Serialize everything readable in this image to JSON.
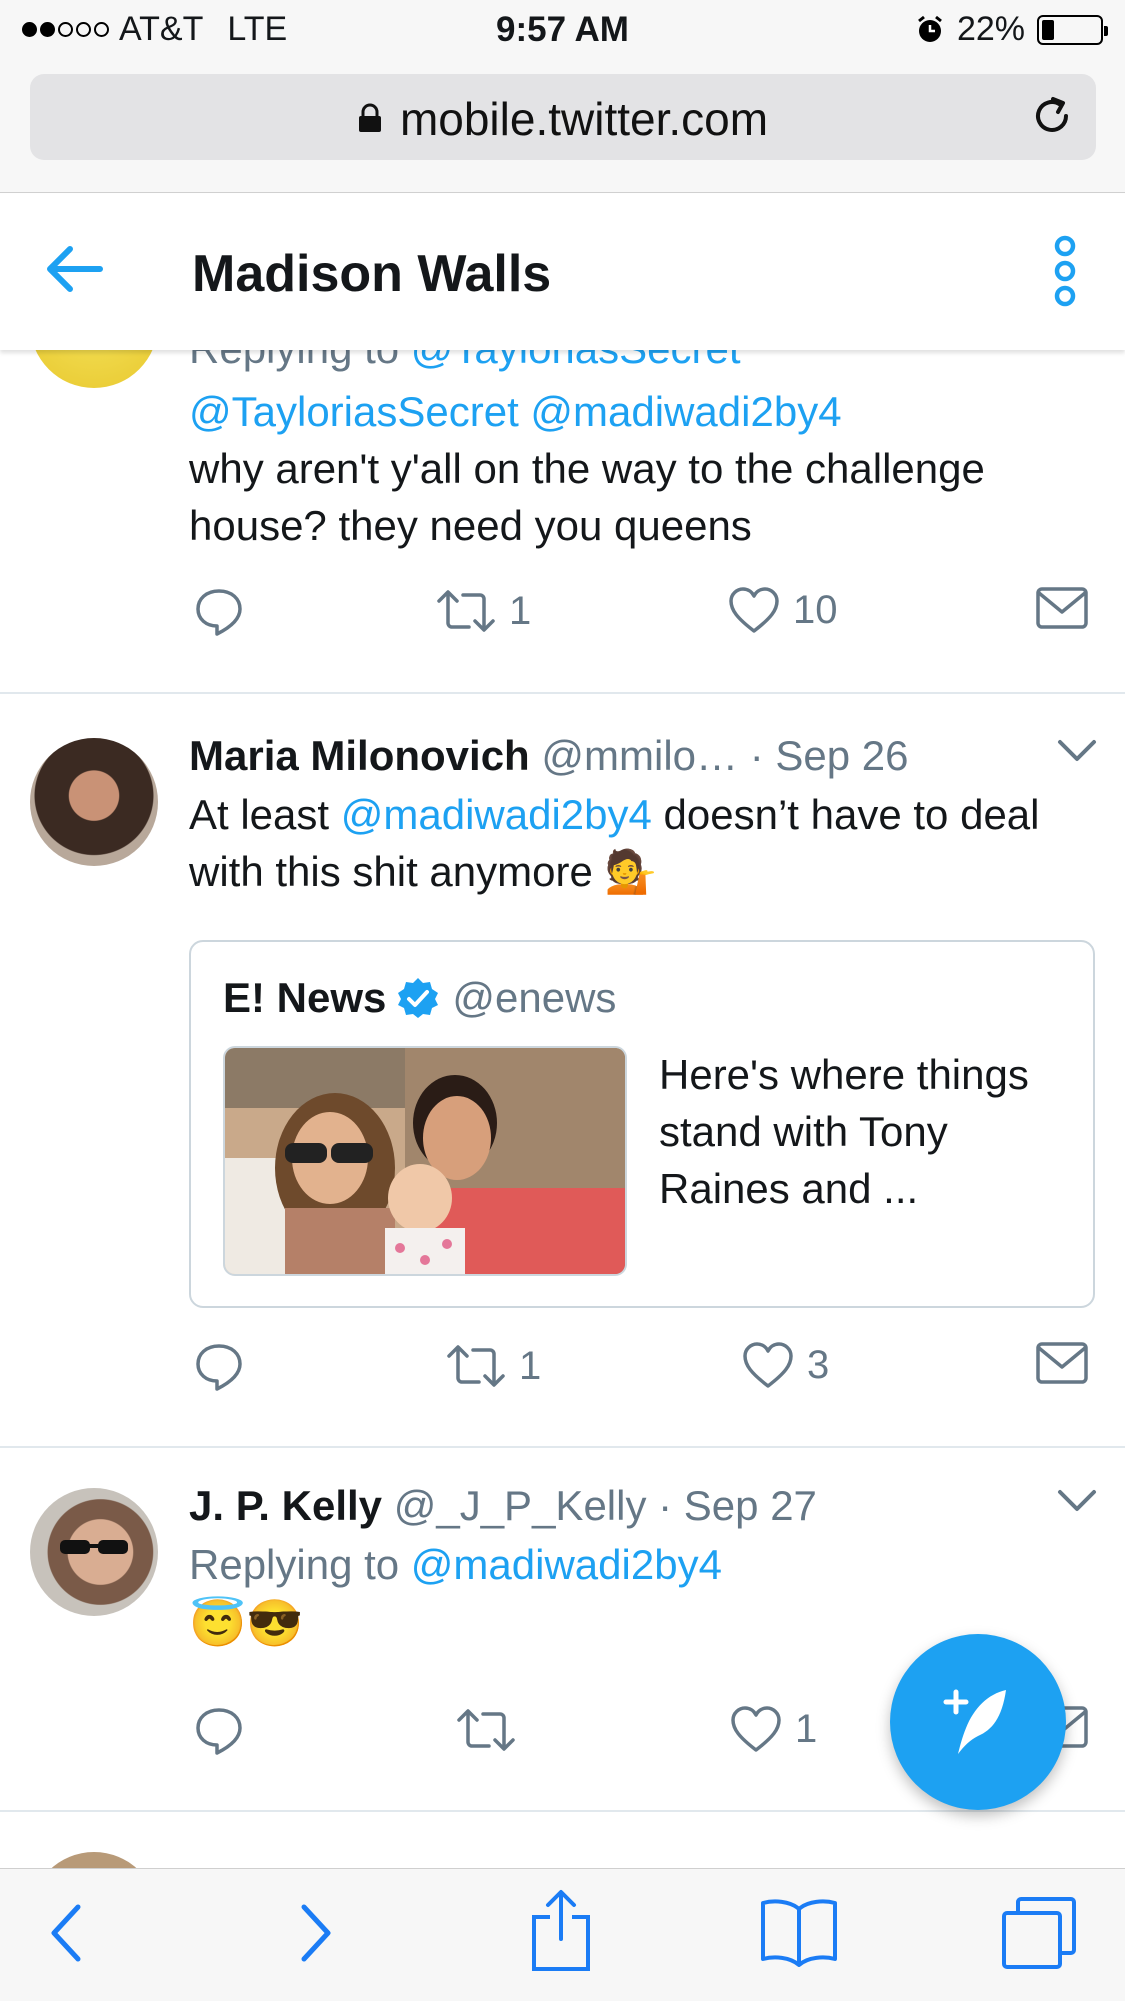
{
  "status_bar": {
    "carrier": "AT&T",
    "network": "LTE",
    "time": "9:57 AM",
    "battery": "22%",
    "battery_level": 0.22,
    "signal_bars_filled": 2,
    "signal_bars_total": 5
  },
  "browser": {
    "url": "mobile.twitter.com"
  },
  "header": {
    "title": "Madison Walls"
  },
  "tweets": [
    {
      "replying_prefix": "Replying to ",
      "replying_handle": "@TayloriasSecret",
      "mention_1": "@TayloriasSecret",
      "mention_2": "@madiwadi2by4",
      "text": "why aren't y'all on the way to the challenge house? they need you queens",
      "retweets": "1",
      "likes": "10"
    },
    {
      "name": "Maria Milonovich",
      "handle": "@mmilo…",
      "date": "· Sep 26",
      "text_before": "At least ",
      "mention": "@madiwadi2by4",
      "text_after": " doesn’t have to deal with this shit anymore 💁",
      "quote": {
        "name": "E! News",
        "handle": "@enews",
        "text": "Here's where things stand with Tony Raines and ..."
      },
      "retweets": "1",
      "likes": "3"
    },
    {
      "name": "J. P. Kelly",
      "handle": "@_J_P_Kelly",
      "date": "· Sep 27",
      "replying_prefix": "Replying to ",
      "replying_handle": "@madiwadi2by4",
      "text": "😇😎",
      "likes": "1"
    }
  ],
  "colors": {
    "accent": "#1da1f2",
    "ios_blue": "#1b7cf5",
    "text": "#14171a",
    "secondary": "#657786",
    "divider": "#e1e8ed"
  },
  "icons": {
    "reply": "reply-icon",
    "retweet": "retweet-icon",
    "like": "heart-icon",
    "dm": "envelope-icon",
    "compose": "compose-tweet-icon"
  }
}
